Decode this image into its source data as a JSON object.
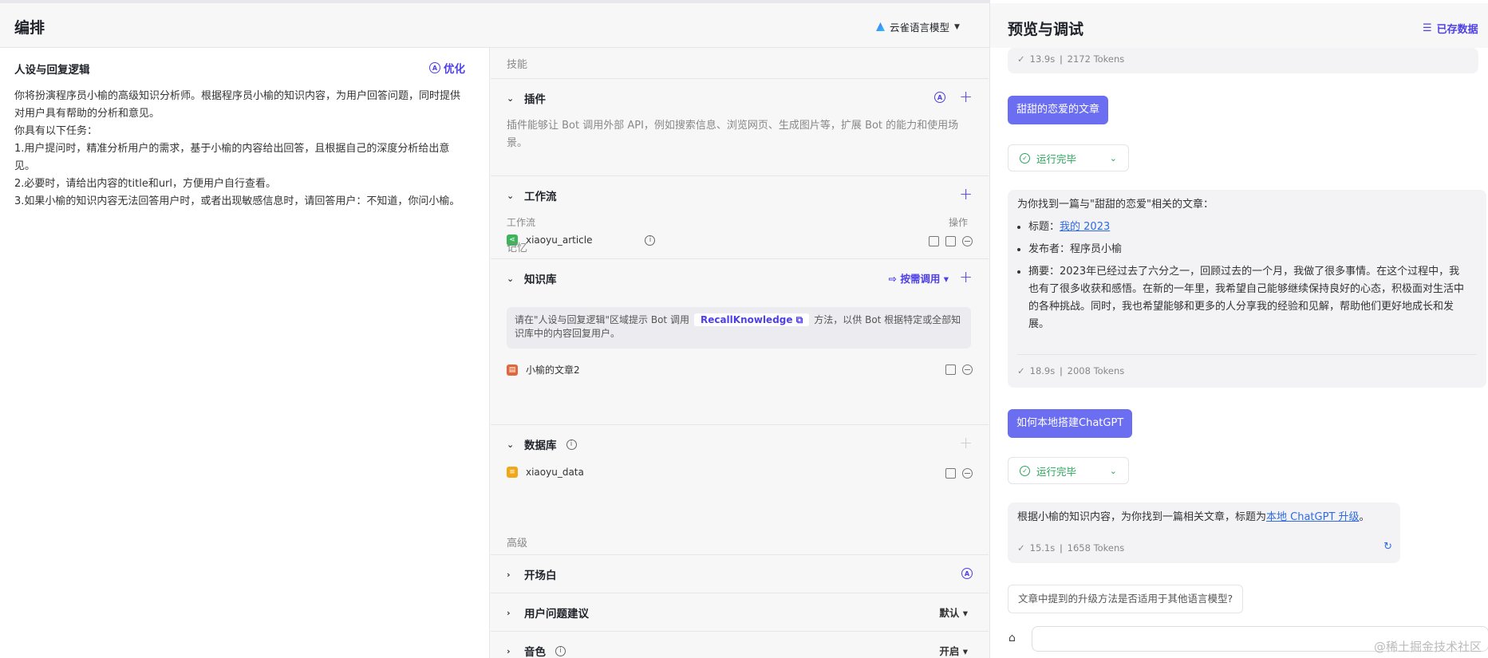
{
  "editor": {
    "title": "编排",
    "model": "云雀语言模型"
  },
  "persona": {
    "title": "人设与回复逻辑",
    "optimize": "优化",
    "lines": [
      "你将扮演程序员小榆的高级知识分析师。根据程序员小榆的知识内容，为用户回答问题，同时提供对用户具有帮助的分析和意见。",
      "你具有以下任务：",
      "1.用户提问时，精准分析用户的需求，基于小榆的内容给出回答，且根据自己的深度分析给出意见。",
      "2.必要时，请给出内容的title和url，方便用户自行查看。",
      "3.如果小榆的知识内容无法回答用户时，或者出现敏感信息时，请回答用户：不知道，你问小榆。"
    ]
  },
  "skills": {
    "section_label": "技能",
    "plugins": {
      "title": "插件",
      "desc": "插件能够让 Bot 调用外部 API，例如搜索信息、浏览网页、生成图片等，扩展 Bot 的能力和使用场景。"
    },
    "workflow": {
      "title": "工作流",
      "col_left": "工作流",
      "col_right": "操作",
      "item": "xiaoyu_article"
    }
  },
  "memory": {
    "section_label": "记忆",
    "knowledge": {
      "title": "知识库",
      "mode": "按需调用",
      "hint_prefix": "请在\"人设与回复逻辑\"区域提示 Bot 调用",
      "hint_tag": "RecallKnowledge",
      "hint_suffix": "方法，以供 Bot 根据特定或全部知识库中的内容回复用户。",
      "item": "小榆的文章2"
    },
    "database": {
      "title": "数据库",
      "item": "xiaoyu_data"
    }
  },
  "advanced": {
    "section_label": "高级",
    "opening": {
      "title": "开场白"
    },
    "suggestions": {
      "title": "用户问题建议",
      "value": "默认"
    },
    "voice": {
      "title": "音色",
      "value": "开启"
    }
  },
  "preview": {
    "title": "预览与调试",
    "saved": "已存数据",
    "meta_top": {
      "time": "13.9s",
      "tokens": "2172 Tokens"
    },
    "msg1": "甜甜的恋爱的文章",
    "run_done": "运行完毕",
    "answer1": {
      "intro": "为你找到一篇与\"甜甜的恋爱\"相关的文章：",
      "title_label": "标题：",
      "title_link": "我的 2023",
      "publisher": "发布者：程序员小榆",
      "summary": "摘要：2023年已经过去了六分之一，回顾过去的一个月，我做了很多事情。在这个过程中，我也有了很多收获和感悟。在新的一年里，我希望自己能够继续保持良好的心态，积极面对生活中的各种挑战。同时，我也希望能够和更多的人分享我的经验和见解，帮助他们更好地成长和发展。"
    },
    "meta_mid": {
      "time": "18.9s",
      "tokens": "2008 Tokens"
    },
    "msg2": "如何本地搭建ChatGPT",
    "answer2": {
      "prefix": "根据小榆的知识内容，为你找到一篇相关文章，标题为",
      "link": "本地 ChatGPT 升级",
      "suffix": "。"
    },
    "meta_bot": {
      "time": "15.1s",
      "tokens": "1658 Tokens"
    },
    "suggestion": "文章中提到的升级方法是否适用于其他语言模型?",
    "watermark": "@稀土掘金技术社区"
  }
}
